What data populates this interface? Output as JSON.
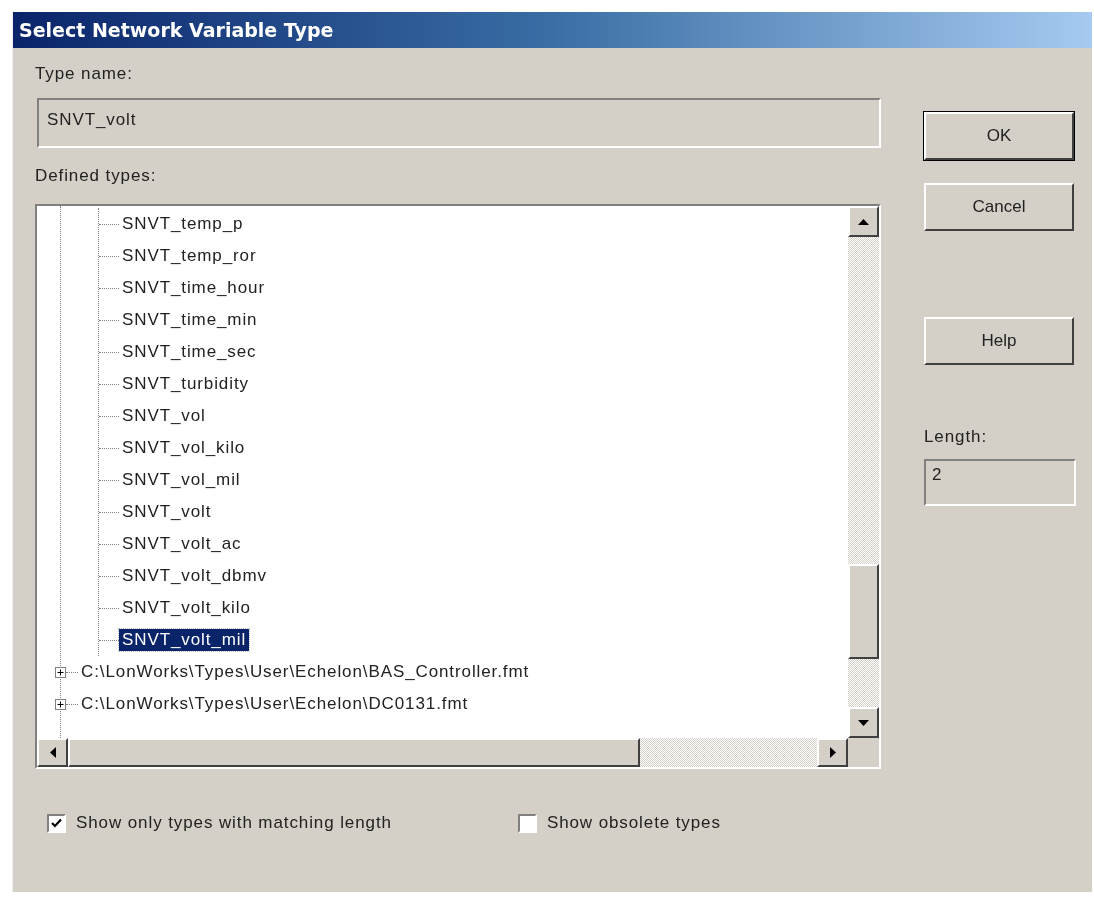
{
  "window": {
    "title": "Select Network Variable Type"
  },
  "type_name": {
    "label": "Type name:",
    "value": "SNVT_volt"
  },
  "defined_types": {
    "label": "Defined types:",
    "tree": [
      {
        "kind": "group",
        "expanded": true,
        "children": [
          {
            "label": "SNVT_temp_p",
            "selected": false
          },
          {
            "label": "SNVT_temp_ror",
            "selected": false
          },
          {
            "label": "SNVT_time_hour",
            "selected": false
          },
          {
            "label": "SNVT_time_min",
            "selected": false
          },
          {
            "label": "SNVT_time_sec",
            "selected": false
          },
          {
            "label": "SNVT_turbidity",
            "selected": false
          },
          {
            "label": "SNVT_vol",
            "selected": false
          },
          {
            "label": "SNVT_vol_kilo",
            "selected": false
          },
          {
            "label": "SNVT_vol_mil",
            "selected": false
          },
          {
            "label": "SNVT_volt",
            "selected": false
          },
          {
            "label": "SNVT_volt_ac",
            "selected": false
          },
          {
            "label": "SNVT_volt_dbmv",
            "selected": false
          },
          {
            "label": "SNVT_volt_kilo",
            "selected": false
          },
          {
            "label": "SNVT_volt_mil",
            "selected": true
          }
        ]
      },
      {
        "kind": "file",
        "label": "C:\\LonWorks\\Types\\User\\Echelon\\BAS_Controller.fmt",
        "expanded": false
      },
      {
        "kind": "file",
        "label": "C:\\LonWorks\\Types\\User\\Echelon\\DC0131.fmt",
        "expanded": false
      }
    ]
  },
  "buttons": [
    {
      "label": "OK",
      "default": true
    },
    {
      "label": "Cancel",
      "default": false
    },
    {
      "label": "Help",
      "default": false
    }
  ],
  "length": {
    "label": "Length:",
    "value": "2"
  },
  "options": [
    {
      "label": "Show only types with matching length",
      "checked": true
    },
    {
      "label": "Show obsolete types",
      "checked": false
    }
  ]
}
